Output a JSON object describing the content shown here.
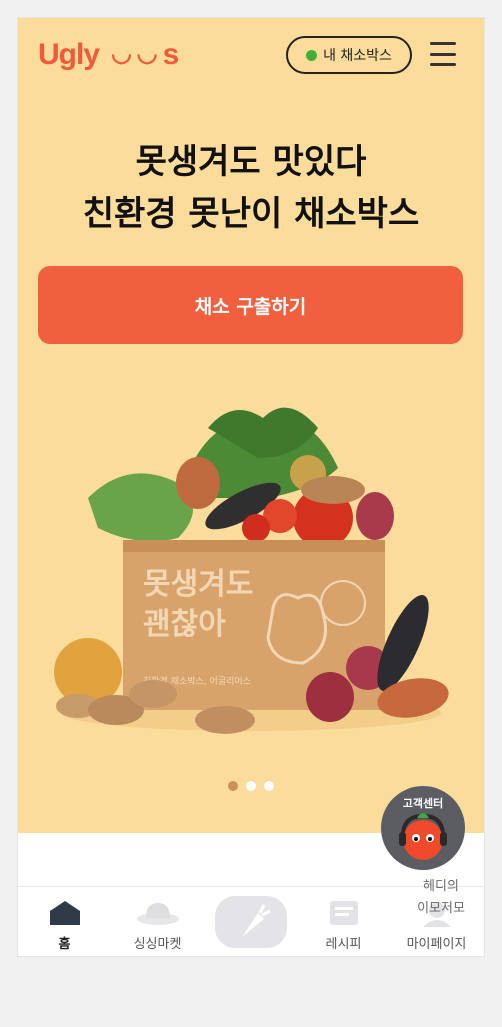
{
  "header": {
    "logo_text": "Ugly Us",
    "my_box_label": "내 채소박스",
    "menu_icon": "hamburger-icon"
  },
  "hero": {
    "headline_line1": "못생겨도 맛있다",
    "headline_line2": "친환경 못난이 채소박스",
    "cta_label": "채소 구출하기",
    "box_print_line1": "못생겨도",
    "box_print_line2": "괜찮아",
    "box_caption": "친환경 채소박스, 어글리어스",
    "carousel_total": 3,
    "carousel_active": 1
  },
  "floating": {
    "customer_center": "고객센터",
    "emoji_line1": "헤디의",
    "emoji_line2": "이모저모"
  },
  "tabs": [
    {
      "label": "홈",
      "icon": "home-icon",
      "active": true
    },
    {
      "label": "싱싱마켓",
      "icon": "hat-icon",
      "active": false
    },
    {
      "label": "",
      "icon": "carrot-icon",
      "active": false
    },
    {
      "label": "레시피",
      "icon": "recipe-icon",
      "active": false
    },
    {
      "label": "마이페이지",
      "icon": "profile-icon",
      "active": false
    }
  ],
  "colors": {
    "brand": "#f0603f",
    "hero_bg": "#fbdc9b",
    "status_dot": "#3fb13a"
  }
}
